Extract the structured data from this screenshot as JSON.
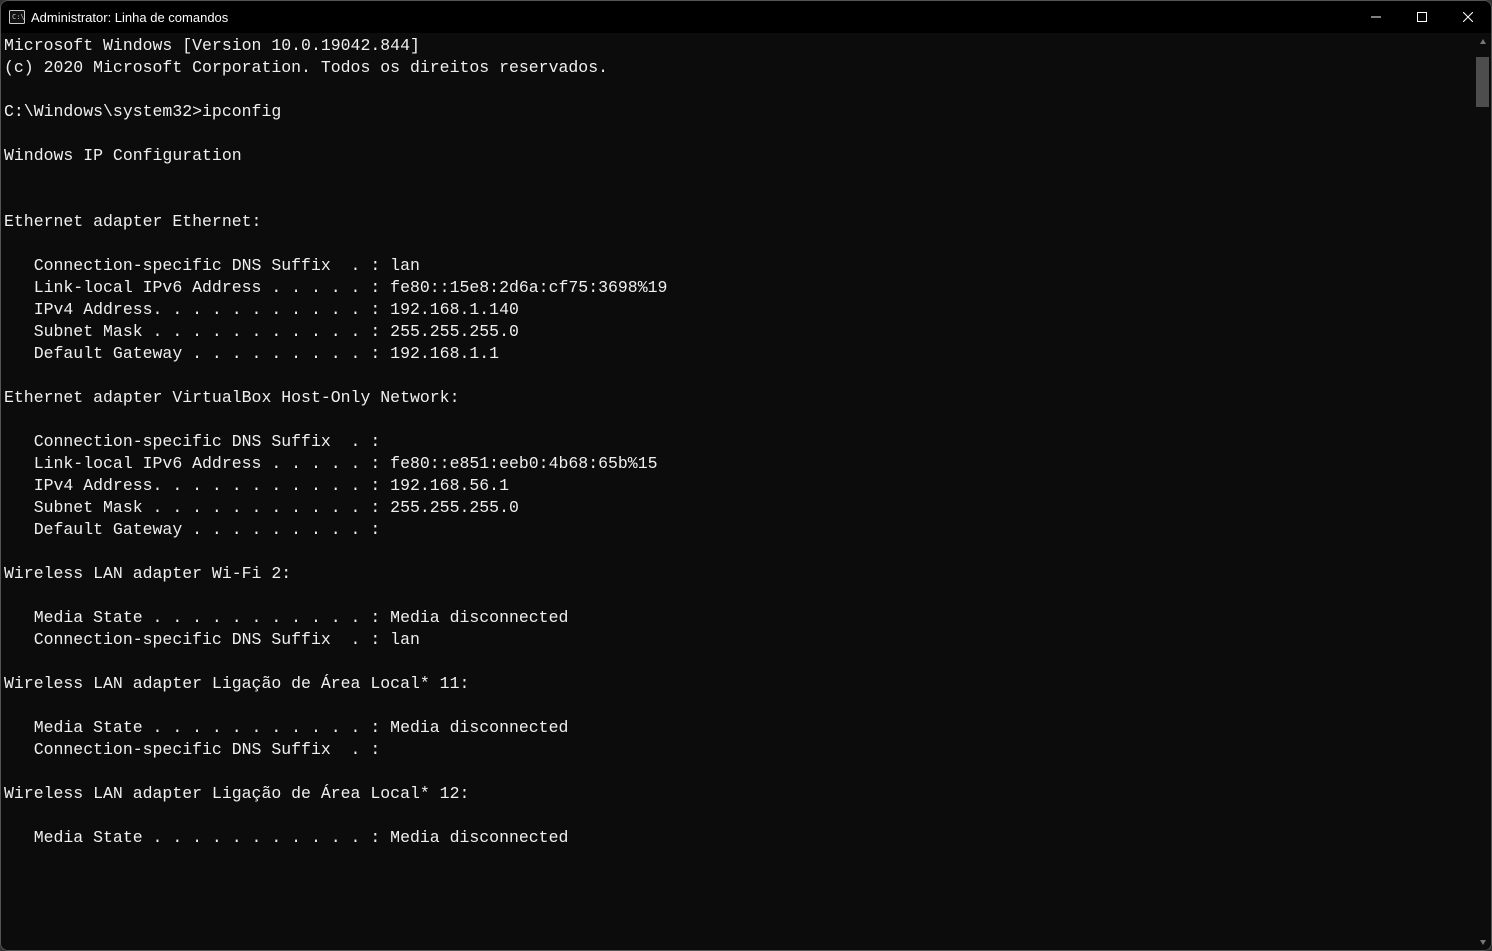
{
  "window": {
    "title": "Administrator: Linha de comandos"
  },
  "banner": {
    "line1": "Microsoft Windows [Version 10.0.19042.844]",
    "line2": "(c) 2020 Microsoft Corporation. Todos os direitos reservados."
  },
  "prompt": {
    "path": "C:\\Windows\\system32>",
    "command": "ipconfig"
  },
  "ipconfig": {
    "header": "Windows IP Configuration",
    "adapters": [
      {
        "title": "Ethernet adapter Ethernet:",
        "fields": [
          {
            "label": "Connection-specific DNS Suffix  . :",
            "value": " lan"
          },
          {
            "label": "Link-local IPv6 Address . . . . . :",
            "value": " fe80::15e8:2d6a:cf75:3698%19"
          },
          {
            "label": "IPv4 Address. . . . . . . . . . . :",
            "value": " 192.168.1.140"
          },
          {
            "label": "Subnet Mask . . . . . . . . . . . :",
            "value": " 255.255.255.0"
          },
          {
            "label": "Default Gateway . . . . . . . . . :",
            "value": " 192.168.1.1"
          }
        ]
      },
      {
        "title": "Ethernet adapter VirtualBox Host-Only Network:",
        "fields": [
          {
            "label": "Connection-specific DNS Suffix  . :",
            "value": ""
          },
          {
            "label": "Link-local IPv6 Address . . . . . :",
            "value": " fe80::e851:eeb0:4b68:65b%15"
          },
          {
            "label": "IPv4 Address. . . . . . . . . . . :",
            "value": " 192.168.56.1"
          },
          {
            "label": "Subnet Mask . . . . . . . . . . . :",
            "value": " 255.255.255.0"
          },
          {
            "label": "Default Gateway . . . . . . . . . :",
            "value": ""
          }
        ]
      },
      {
        "title": "Wireless LAN adapter Wi-Fi 2:",
        "fields": [
          {
            "label": "Media State . . . . . . . . . . . :",
            "value": " Media disconnected"
          },
          {
            "label": "Connection-specific DNS Suffix  . :",
            "value": " lan"
          }
        ]
      },
      {
        "title": "Wireless LAN adapter Ligação de Área Local* 11:",
        "fields": [
          {
            "label": "Media State . . . . . . . . . . . :",
            "value": " Media disconnected"
          },
          {
            "label": "Connection-specific DNS Suffix  . :",
            "value": ""
          }
        ]
      },
      {
        "title": "Wireless LAN adapter Ligação de Área Local* 12:",
        "fields": [
          {
            "label": "Media State . . . . . . . . . . . :",
            "value": " Media disconnected"
          }
        ]
      }
    ]
  }
}
